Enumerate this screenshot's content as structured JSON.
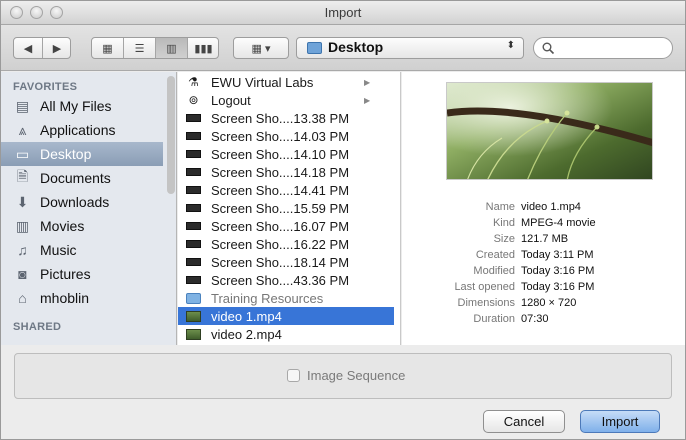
{
  "window": {
    "title": "Import"
  },
  "toolbar": {
    "location": "Desktop",
    "view_icons": [
      "icon-view-icon",
      "list-view-icon",
      "column-view-icon",
      "coverflow-view-icon"
    ],
    "arrange_icon": "arrange-menu-icon"
  },
  "sidebar": {
    "favorites_header": "FAVORITES",
    "shared_header": "SHARED",
    "items": [
      {
        "label": "All My Files",
        "icon": "all-files-icon",
        "selected": false
      },
      {
        "label": "Applications",
        "icon": "applications-icon",
        "selected": false
      },
      {
        "label": "Desktop",
        "icon": "desktop-icon",
        "selected": true
      },
      {
        "label": "Documents",
        "icon": "documents-icon",
        "selected": false
      },
      {
        "label": "Downloads",
        "icon": "downloads-icon",
        "selected": false
      },
      {
        "label": "Movies",
        "icon": "movies-icon",
        "selected": false
      },
      {
        "label": "Music",
        "icon": "music-icon",
        "selected": false
      },
      {
        "label": "Pictures",
        "icon": "pictures-icon",
        "selected": false
      },
      {
        "label": "mhoblin",
        "icon": "home-icon",
        "selected": false
      }
    ]
  },
  "files": [
    {
      "name": "EWU Virtual Labs",
      "icon": "app-icon",
      "arrow": true
    },
    {
      "name": "Logout",
      "icon": "app-icon",
      "arrow": true
    },
    {
      "name": "Screen Sho....13.38 PM",
      "icon": "screenshot-icon"
    },
    {
      "name": "Screen Sho....14.03 PM",
      "icon": "screenshot-icon"
    },
    {
      "name": "Screen Sho....14.10 PM",
      "icon": "screenshot-icon"
    },
    {
      "name": "Screen Sho....14.18 PM",
      "icon": "screenshot-icon"
    },
    {
      "name": "Screen Sho....14.41 PM",
      "icon": "screenshot-icon"
    },
    {
      "name": "Screen Sho....15.59 PM",
      "icon": "screenshot-icon"
    },
    {
      "name": "Screen Sho....16.07 PM",
      "icon": "screenshot-icon"
    },
    {
      "name": "Screen Sho....16.22 PM",
      "icon": "screenshot-icon"
    },
    {
      "name": "Screen Sho....18.14 PM",
      "icon": "screenshot-icon"
    },
    {
      "name": "Screen Sho....43.36 PM",
      "icon": "screenshot-icon"
    },
    {
      "name": "Training Resources",
      "icon": "folder-icon",
      "dim": true
    },
    {
      "name": "video 1.mp4",
      "icon": "video-icon",
      "selected": true
    },
    {
      "name": "video 2.mp4",
      "icon": "video-icon"
    }
  ],
  "preview": {
    "info": [
      {
        "key": "Name",
        "value": "video 1.mp4"
      },
      {
        "key": "Kind",
        "value": "MPEG-4 movie"
      },
      {
        "key": "Size",
        "value": "121.7 MB"
      },
      {
        "key": "Created",
        "value": "Today 3:11 PM"
      },
      {
        "key": "Modified",
        "value": "Today 3:16 PM"
      },
      {
        "key": "Last opened",
        "value": "Today 3:16 PM"
      },
      {
        "key": "Dimensions",
        "value": "1280 × 720"
      },
      {
        "key": "Duration",
        "value": "07:30"
      }
    ]
  },
  "accessory": {
    "image_sequence_label": "Image Sequence"
  },
  "buttons": {
    "cancel": "Cancel",
    "import": "Import"
  }
}
